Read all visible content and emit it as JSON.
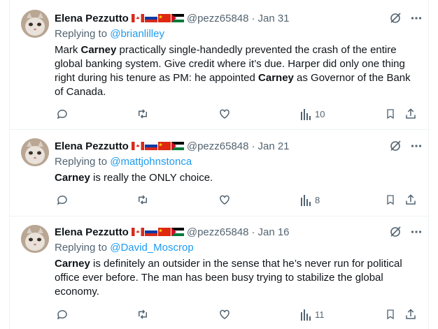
{
  "tweets": [
    {
      "author": "Elena Pezzutto",
      "handle": "@pezz65848",
      "sep": "·",
      "date": "Jan 31",
      "replying_prefix": "Replying to ",
      "replying_to": "@brianlilley",
      "text_parts": [
        {
          "t": "Mark ",
          "b": false
        },
        {
          "t": "Carney",
          "b": true
        },
        {
          "t": " practically single-handedly prevented the crash of the entire global banking system. Give credit where it’s due. Harper did only one thing right during his tenure as PM: he appointed ",
          "b": false
        },
        {
          "t": "Carney",
          "b": true
        },
        {
          "t": " as Governor of the Bank of Canada.",
          "b": false
        }
      ],
      "views": "10"
    },
    {
      "author": "Elena Pezzutto",
      "handle": "@pezz65848",
      "sep": "·",
      "date": "Jan 21",
      "replying_prefix": "Replying to ",
      "replying_to": "@mattjohnstonca",
      "text_parts": [
        {
          "t": "Carney",
          "b": true
        },
        {
          "t": " is really the ONLY choice.",
          "b": false
        }
      ],
      "views": "8"
    },
    {
      "author": "Elena Pezzutto",
      "handle": "@pezz65848",
      "sep": "·",
      "date": "Jan 16",
      "replying_prefix": "Replying to ",
      "replying_to": "@David_Moscrop",
      "text_parts": [
        {
          "t": "Carney",
          "b": true
        },
        {
          "t": " is definitely an outsider in the sense that he’s never run for political office ever before. The man has been busy trying to stabilize the global economy.",
          "b": false
        }
      ],
      "views": "11"
    }
  ],
  "icons": {
    "flags": [
      "canada-flag-icon",
      "russia-flag-icon",
      "china-flag-icon",
      "palestine-flag-icon"
    ],
    "actions": [
      "reply-icon",
      "retweet-icon",
      "like-icon",
      "views-icon",
      "bookmark-icon",
      "share-icon"
    ],
    "top": [
      "grok-icon",
      "more-icon"
    ]
  },
  "colors": {
    "text": "#0f1419",
    "secondary": "#536471",
    "link": "#1d9bf0",
    "border": "#eff3f4"
  }
}
